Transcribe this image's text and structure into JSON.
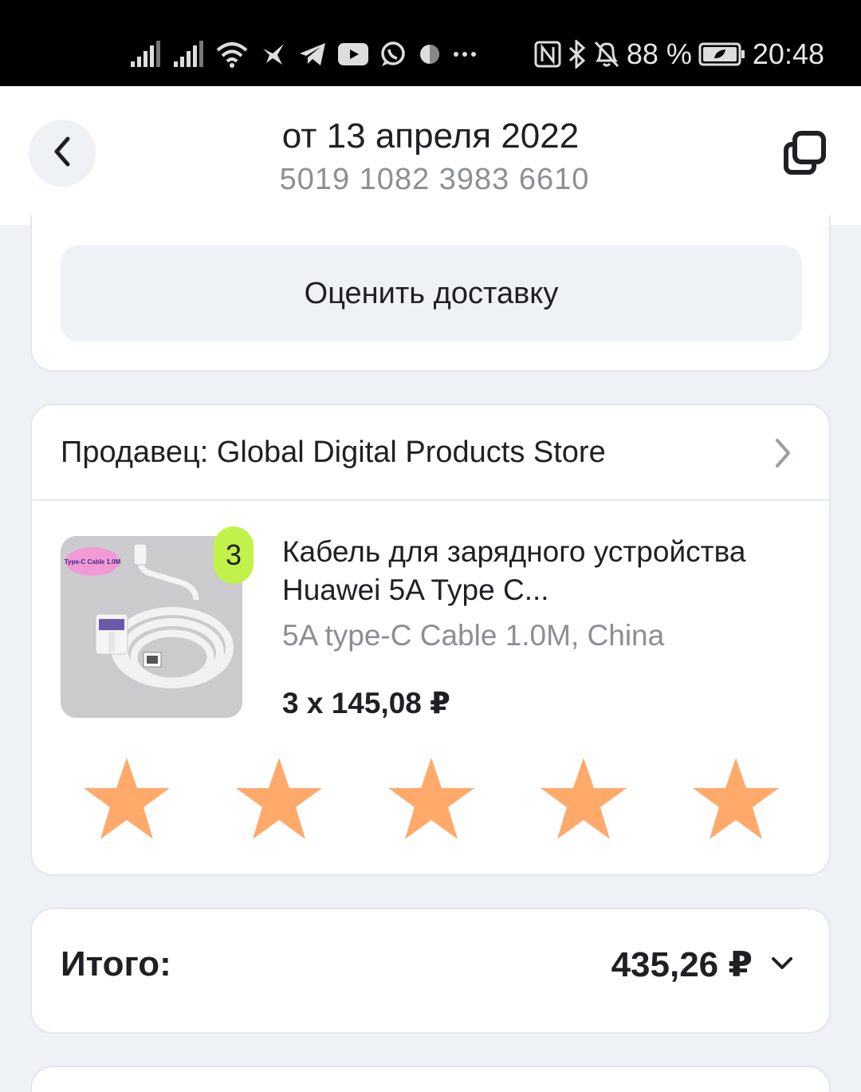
{
  "status_bar": {
    "battery_percent": "88 %",
    "time": "20:48",
    "icons": [
      "signal-icon",
      "signal-icon",
      "wifi-icon",
      "bird-app-icon",
      "telegram-icon",
      "youtube-icon",
      "whatsapp-icon",
      "app-icon",
      "more-dots-icon",
      "nfc-icon",
      "bluetooth-icon",
      "mute-icon",
      "battery-icon"
    ]
  },
  "header": {
    "title": "от 13 апреля 2022",
    "order_number": "5019 1082 3983 6610",
    "back_icon": "chevron-left-icon",
    "copy_icon": "copy-icon"
  },
  "delivery": {
    "rate_button_label": "Оценить доставку"
  },
  "order": {
    "seller_label": "Продавец: Global Digital Products Store",
    "product": {
      "quantity_badge": "3",
      "image_caption": "Type-C Cable 1.0M",
      "title": "Кабель для зарядного устройства Huawei 5A Type C...",
      "variant": "5A type-C Cable 1.0M, China",
      "price_line": "3 x 145,08 ₽"
    },
    "rating": {
      "stars_total": 5,
      "stars_filled": 5,
      "star_color": "#ffa96b"
    }
  },
  "summary": {
    "total_label": "Итого:",
    "total_value": "435,26 ₽"
  },
  "colors": {
    "page_bg": "#eef1f6",
    "badge_green": "#c2f24a",
    "muted_text": "#8b8e93"
  }
}
